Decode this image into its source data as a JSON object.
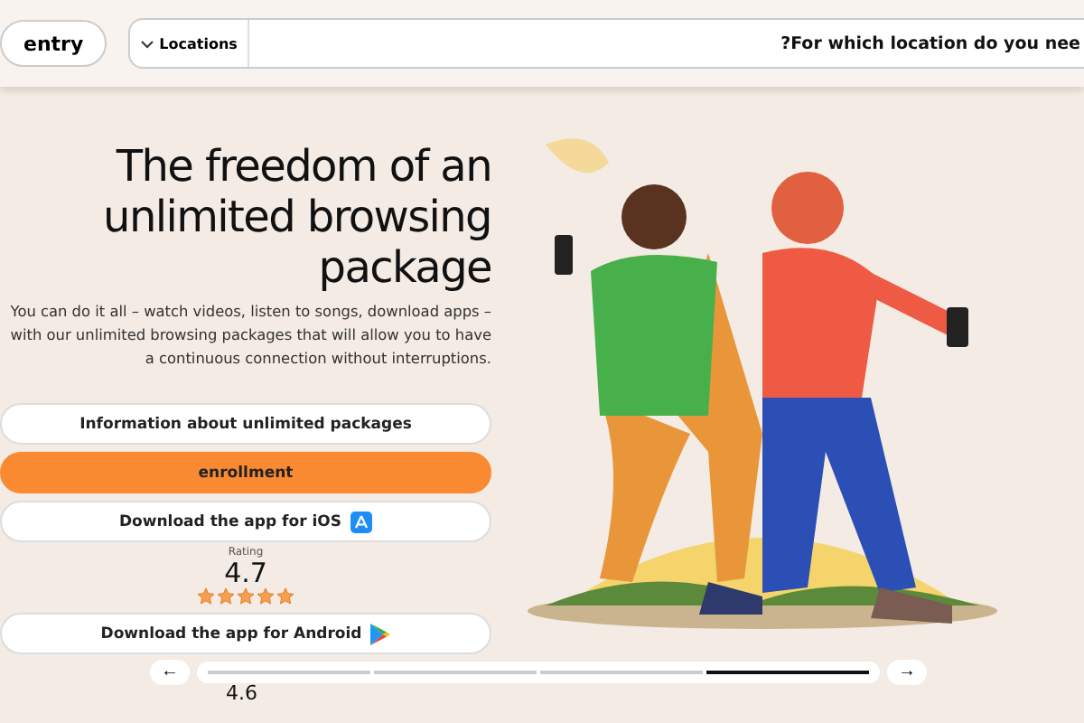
{
  "header": {
    "login": "entry",
    "locations": "Locations",
    "search": {
      "placeholder": "?For which location do you nee"
    }
  },
  "hero": {
    "title": "The freedom of an unlimited browsing package",
    "text": "You can do it all – watch videos, listen to songs, download apps – with our unlimited browsing packages that will allow you to have a continuous connection without interruptions."
  },
  "buttons": [
    {
      "label": "Information about unlimited packages",
      "kind": "plain"
    },
    {
      "label": "enrollment",
      "kind": "primary"
    },
    {
      "label": "Download the app for iOS",
      "kind": "ios"
    }
  ],
  "ios_rating": {
    "label": "Rating",
    "value": "4.7",
    "stars": 5
  },
  "android": {
    "label": "Download the app for Android",
    "rating": "4.6"
  },
  "carousel": {
    "prev": "←",
    "next": "→",
    "segments": [
      {
        "selected": false
      },
      {
        "selected": false
      },
      {
        "selected": false
      },
      {
        "selected": true
      }
    ]
  }
}
